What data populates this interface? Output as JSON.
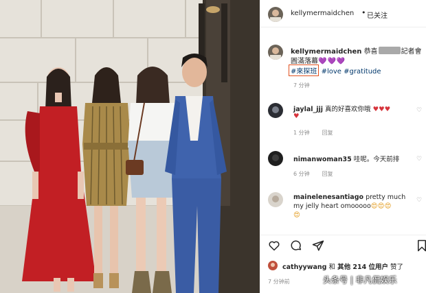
{
  "header": {
    "username": "kellymermaidchen",
    "dot": "•",
    "follow_label": "已关注"
  },
  "caption": {
    "username": "kellymermaidchen",
    "text_before_blur": "恭喜",
    "text_after_blur": "記者會",
    "line2": "圓滿落幕",
    "hearts": "💜💜💜",
    "highlighted_tag": "#來探班",
    "tags": "#love #gratitude",
    "time": "7 分钟"
  },
  "comments": [
    {
      "username": "jaylal_jjj",
      "text": "真的好喜欢你哦",
      "hearts": "♥♥♥",
      "hearts_line2": "♥",
      "time": "1 分钟",
      "reply": "回复"
    },
    {
      "username": "nimanwoman35",
      "text": "哇呢。今天前排",
      "time": "6 分钟",
      "reply": "回复"
    },
    {
      "username": "mainelenesantiago",
      "text": "pretty much",
      "line2": "my jelly heart omooooo",
      "emojis": "😍😍😍",
      "emoji_line2": "😍",
      "time": "",
      "reply": ""
    }
  ],
  "actions": {
    "like_icon": "heart-outline-icon",
    "comment_icon": "comment-bubble-icon",
    "share_icon": "paper-plane-icon",
    "save_icon": "bookmark-icon"
  },
  "likes": {
    "username": "cathyywang",
    "connector": "和",
    "others_label": "其他 214 位用户",
    "suffix": "赞了"
  },
  "post_time": "7 分钟前",
  "watermark": "头条号 | 非凡侃娱乐",
  "colors": {
    "highlight_box": "#e0501e",
    "hashtag": "#00376b",
    "muted": "#8e8e8e",
    "purple_heart": "#9b59d6",
    "red_heart": "#d6343c"
  }
}
